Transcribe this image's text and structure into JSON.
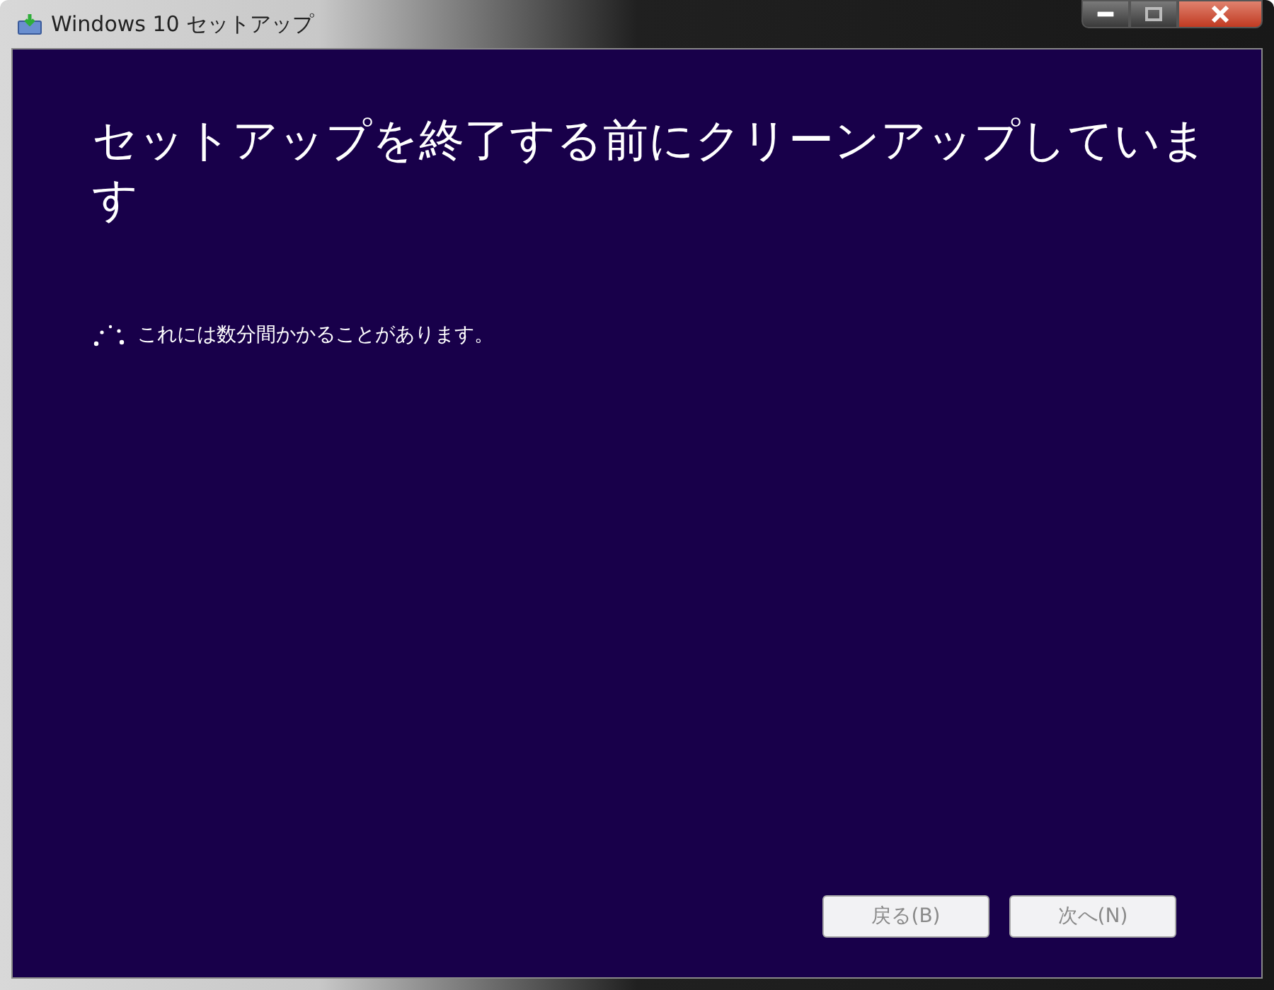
{
  "window": {
    "title": "Windows 10 セットアップ"
  },
  "heading": "セットアップを終了する前にクリーンアップしています",
  "status": "これには数分間かかることがあります。",
  "buttons": [
    {
      "label": "戻る(B)",
      "disabled": true
    },
    {
      "label": "次へ(N)",
      "disabled": true
    }
  ]
}
